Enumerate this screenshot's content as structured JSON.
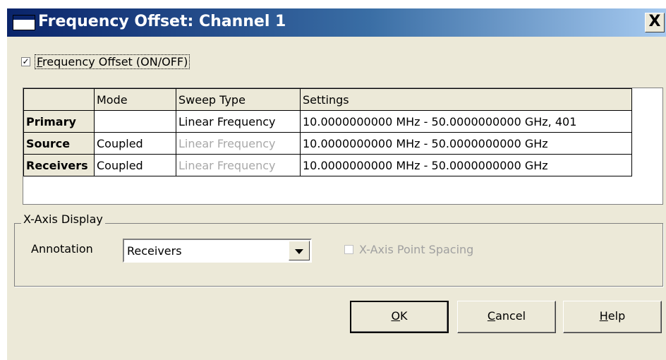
{
  "dialog": {
    "title": "Frequency Offset: Channel 1",
    "close_glyph": "X"
  },
  "offset_checkbox": {
    "checked": true,
    "glyph": "✓",
    "label_accel": "F",
    "label_rest": "requency Offset (ON/OFF)"
  },
  "table": {
    "headers": [
      "",
      "Mode",
      "Sweep Type",
      "Settings"
    ],
    "rows": [
      {
        "name": "Primary",
        "mode": "",
        "sweep_type": "Linear Frequency",
        "sweep_type_enabled": true,
        "settings": "10.0000000000 MHz - 50.0000000000 GHz, 401"
      },
      {
        "name": "Source",
        "mode": "Coupled",
        "sweep_type": "Linear Frequency",
        "sweep_type_enabled": false,
        "settings": "10.0000000000 MHz - 50.0000000000 GHz"
      },
      {
        "name": "Receivers",
        "mode": "Coupled",
        "sweep_type": "Linear Frequency",
        "sweep_type_enabled": false,
        "settings": "10.0000000000 MHz - 50.0000000000 GHz"
      }
    ]
  },
  "x_axis_display": {
    "group_title": "X-Axis Display",
    "annotation_label": "Annotation",
    "annotation_value": "Receivers",
    "point_spacing": {
      "label": "X-Axis Point Spacing",
      "checked": false,
      "enabled": false
    }
  },
  "buttons": {
    "ok": {
      "accel": "O",
      "rest": "K"
    },
    "cancel": {
      "accel": "C",
      "rest": "ancel"
    },
    "help": {
      "accel": "H",
      "rest": "elp"
    }
  },
  "colors": {
    "dialog_bg": "#ece9d8",
    "title_gradient_start": "#0a246a",
    "title_gradient_end": "#a6caf0",
    "disabled_text": "#a8a8a8"
  }
}
